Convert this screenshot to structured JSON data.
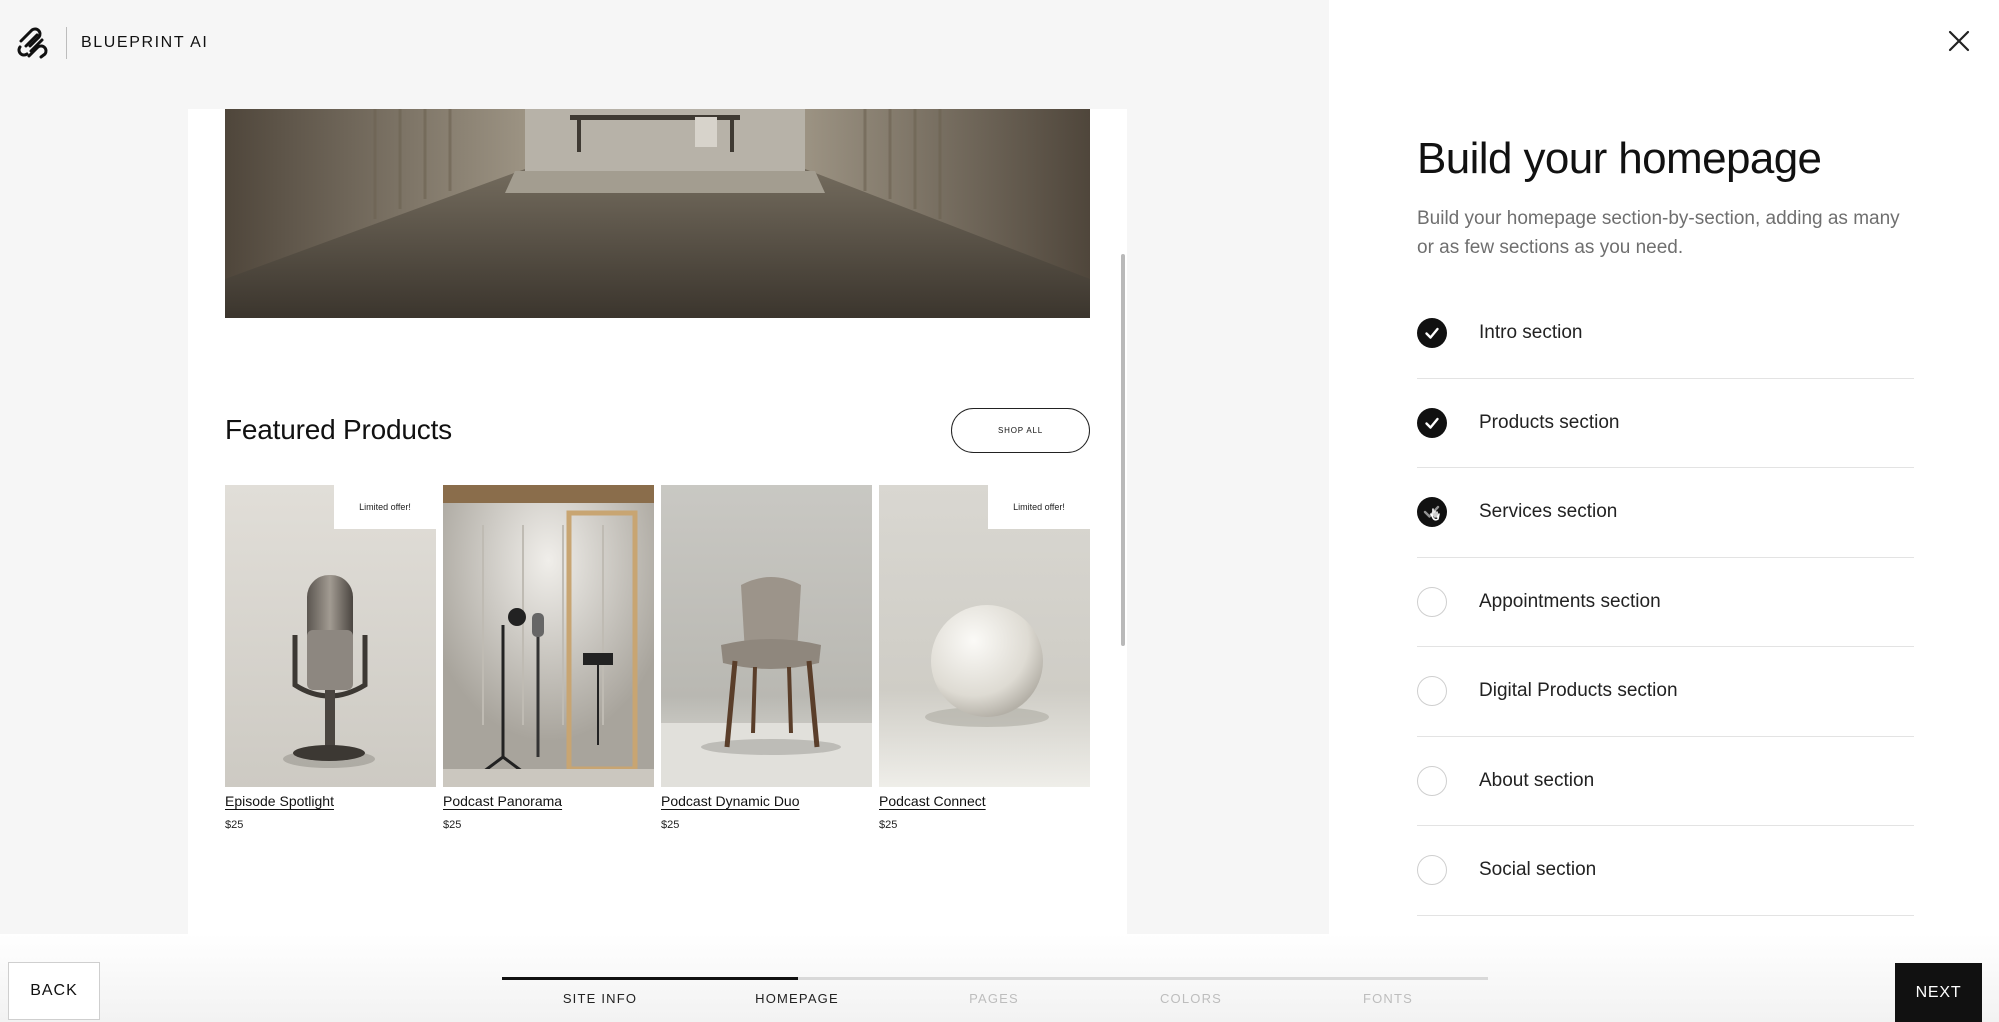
{
  "header": {
    "brand_name": "BLUEPRINT AI"
  },
  "preview": {
    "featured_title": "Featured Products",
    "shop_all_label": "SHOP ALL",
    "products": [
      {
        "name": "Episode Spotlight",
        "price": "$25",
        "badge": "Limited offer!"
      },
      {
        "name": "Podcast Panorama",
        "price": "$25",
        "badge": ""
      },
      {
        "name": "Podcast Dynamic Duo",
        "price": "$25",
        "badge": ""
      },
      {
        "name": "Podcast Connect",
        "price": "$25",
        "badge": "Limited offer!"
      }
    ]
  },
  "panel": {
    "title": "Build your homepage",
    "description": "Build your homepage section-by-section, adding as many or as few sections as you need.",
    "sections": [
      {
        "label": "Intro section",
        "checked": true
      },
      {
        "label": "Products section",
        "checked": true
      },
      {
        "label": "Services section",
        "checked": true
      },
      {
        "label": "Appointments section",
        "checked": false
      },
      {
        "label": "Digital Products section",
        "checked": false
      },
      {
        "label": "About section",
        "checked": false
      },
      {
        "label": "Social section",
        "checked": false
      }
    ]
  },
  "footer": {
    "back_label": "BACK",
    "next_label": "NEXT",
    "progress": 0.3,
    "steps": [
      {
        "label": "SITE INFO",
        "complete": true
      },
      {
        "label": "HOMEPAGE",
        "complete": true
      },
      {
        "label": "PAGES",
        "complete": false
      },
      {
        "label": "COLORS",
        "complete": false
      },
      {
        "label": "FONTS",
        "complete": false
      }
    ]
  },
  "icons": {
    "brand": "squarespace-logo-icon",
    "close": "close-icon",
    "check": "checkmark-icon"
  },
  "colors": {
    "accent": "#111111",
    "muted": "#6f6f6f",
    "inactive_step": "#bdbdbd"
  }
}
